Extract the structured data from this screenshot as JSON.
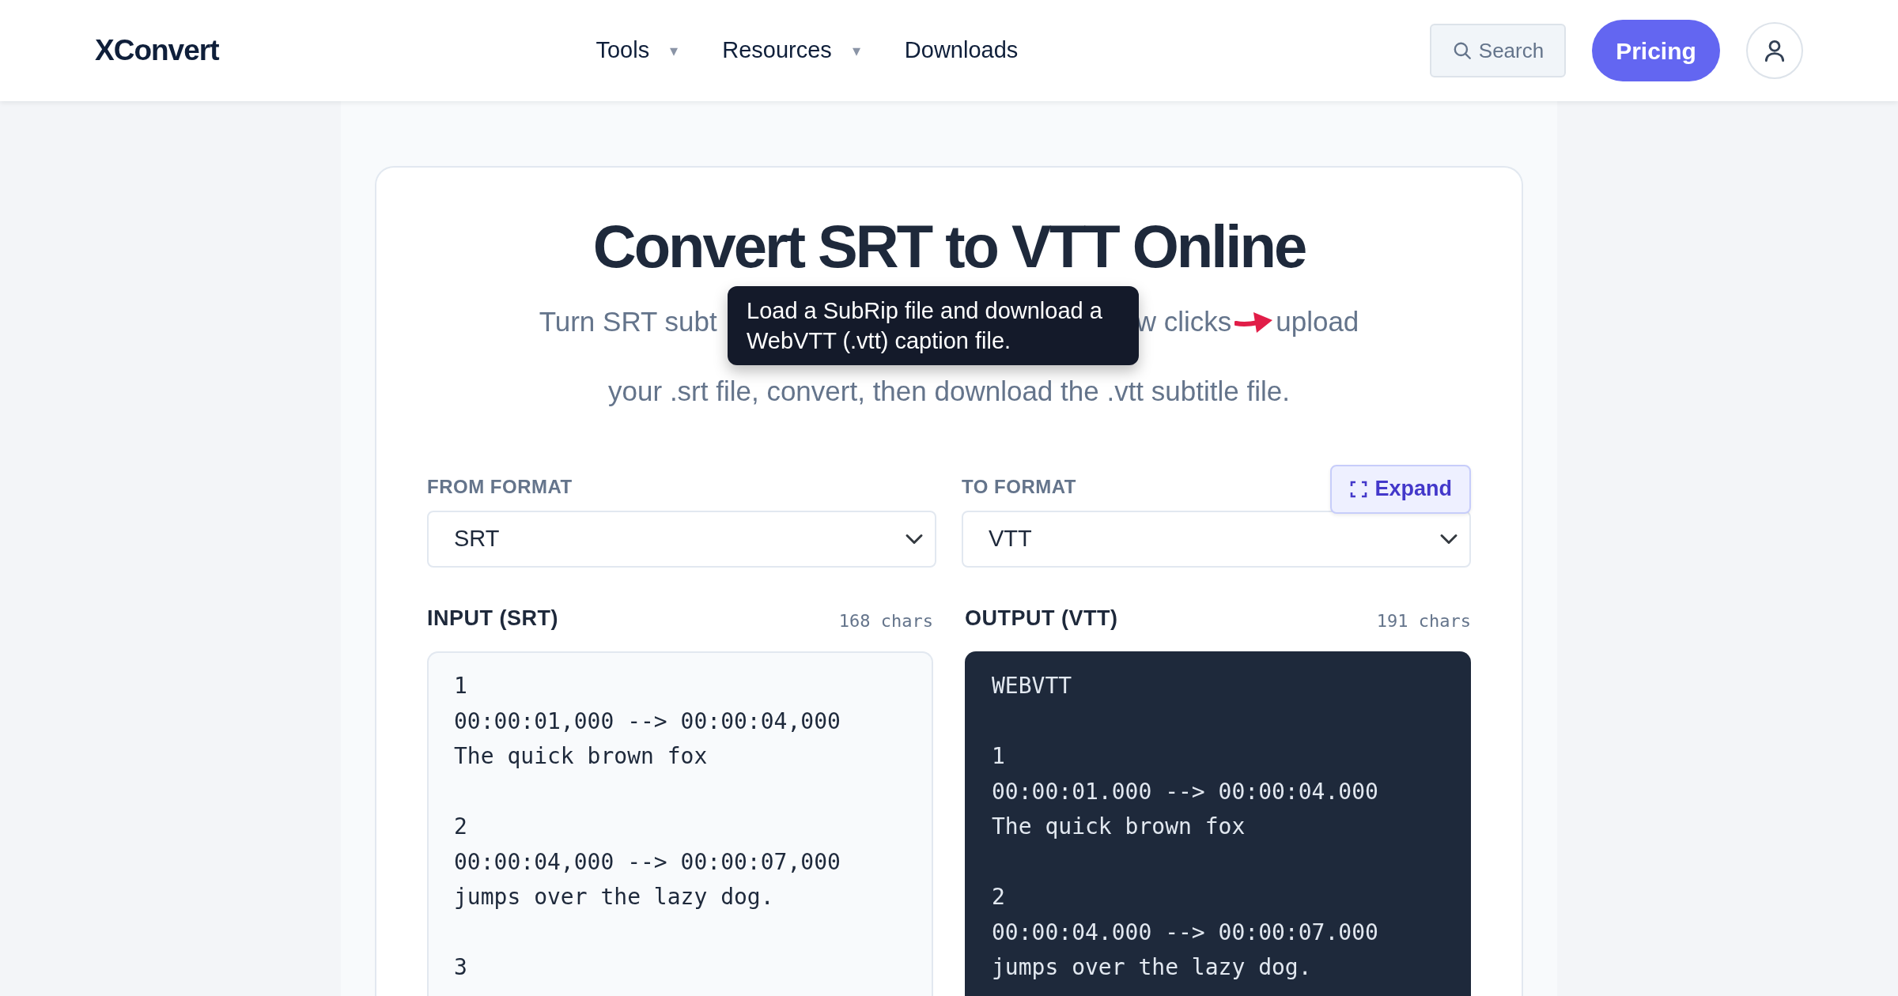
{
  "header": {
    "logo": "XConvert",
    "nav": [
      {
        "label": "Tools",
        "caret": "▾"
      },
      {
        "label": "Resources",
        "caret": "▾"
      },
      {
        "label": "Downloads"
      }
    ],
    "search": {
      "label": "Search"
    },
    "pricing": "Pricing"
  },
  "hero": {
    "title": "Convert SRT to VTT Online",
    "subtitle_line1_left": "Turn SRT subt",
    "subtitle_line1_right": "w clicks",
    "subtitle_line1_end": "upload",
    "subtitle_line2": "your .srt file, convert, then download the .vtt subtitle file.",
    "tooltip": "Load a SubRip file and download a WebVTT (.vtt) caption file."
  },
  "formats": [
    {
      "label": "FROM FORMAT",
      "value": "SRT"
    },
    {
      "label": "TO FORMAT",
      "value": "VTT"
    }
  ],
  "expand_button": "Expand",
  "panels": [
    {
      "kind": "input",
      "label": "INPUT (SRT)",
      "count": "168 chars",
      "blocks": [
        [
          "1",
          "00:00:01,000 --> 00:00:04,000",
          "The quick brown fox"
        ],
        [
          "2",
          "00:00:04,000 --> 00:00:07,000",
          "jumps over the lazy dog."
        ],
        [
          "3"
        ]
      ]
    },
    {
      "kind": "output",
      "label": "OUTPUT (VTT)",
      "count": "191 chars",
      "blocks": [
        [
          "WEBVTT"
        ],
        [
          "1",
          "00:00:01.000 --> 00:00:04.000",
          "The quick brown fox"
        ],
        [
          "2",
          "00:00:04.000 --> 00:00:07.000",
          "jumps over the lazy dog."
        ]
      ]
    }
  ]
}
